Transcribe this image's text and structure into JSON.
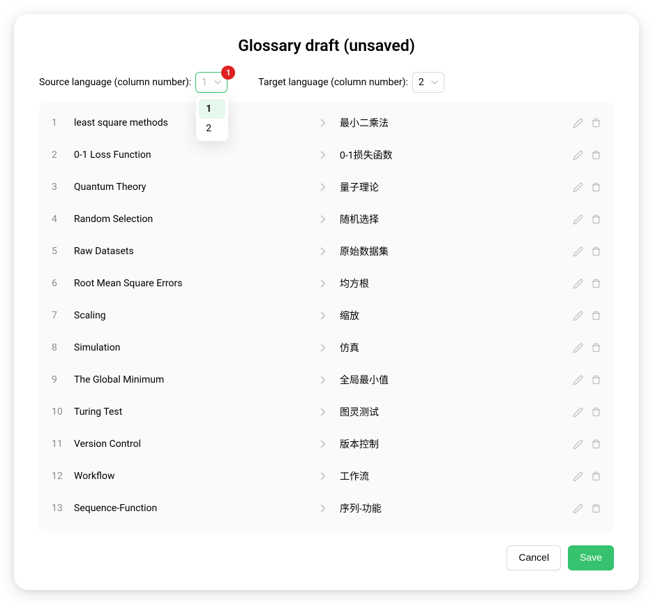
{
  "title": "Glossary draft (unsaved)",
  "sourceLabel": "Source language (column number):",
  "targetLabel": "Target language (column number):",
  "sourceSelected": "1",
  "targetSelected": "2",
  "badge": "1",
  "dropdownOptions": [
    "1",
    "2"
  ],
  "rows": [
    {
      "n": "1",
      "source": "least square methods",
      "target": "最小二乘法"
    },
    {
      "n": "2",
      "source": "0-1 Loss Function",
      "target": "0-1损失函数"
    },
    {
      "n": "3",
      "source": "Quantum Theory",
      "target": "量子理论"
    },
    {
      "n": "4",
      "source": "Random Selection",
      "target": "随机选择"
    },
    {
      "n": "5",
      "source": "Raw Datasets",
      "target": "原始数据集"
    },
    {
      "n": "6",
      "source": "Root Mean Square Errors",
      "target": "均方根"
    },
    {
      "n": "7",
      "source": "Scaling",
      "target": "缩放"
    },
    {
      "n": "8",
      "source": "Simulation",
      "target": "仿真"
    },
    {
      "n": "9",
      "source": "The Global Minimum",
      "target": "全局最小值"
    },
    {
      "n": "10",
      "source": "Turing Test",
      "target": "图灵测试"
    },
    {
      "n": "11",
      "source": "Version Control",
      "target": "版本控制"
    },
    {
      "n": "12",
      "source": "Workflow",
      "target": "工作流"
    },
    {
      "n": "13",
      "source": "Sequence-Function",
      "target": "序列-功能"
    }
  ],
  "cancelLabel": "Cancel",
  "saveLabel": "Save"
}
